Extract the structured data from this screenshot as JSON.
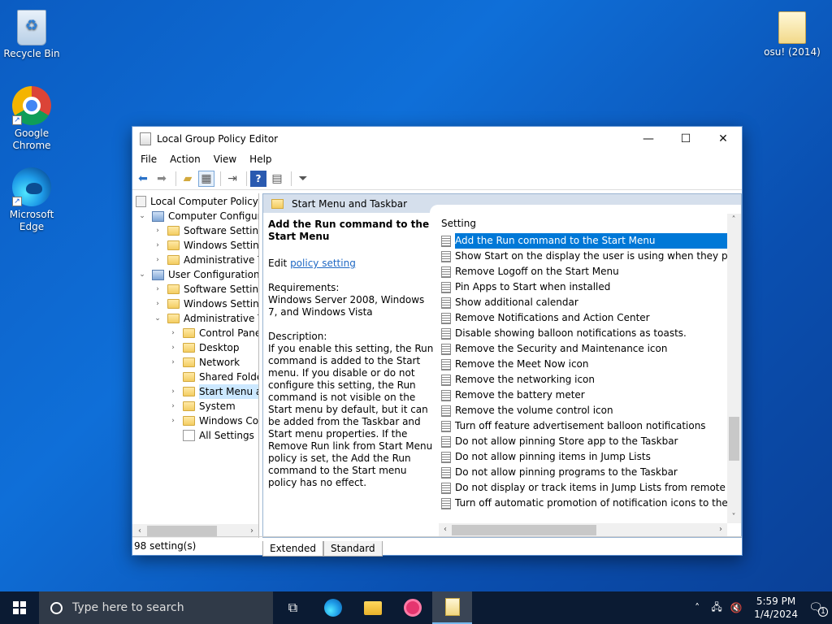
{
  "desktop": {
    "icons": [
      {
        "label": "Recycle Bin"
      },
      {
        "label": "Google Chrome"
      },
      {
        "label": "Microsoft Edge"
      },
      {
        "label": "osu! (2014)"
      }
    ]
  },
  "window": {
    "title": "Local Group Policy Editor",
    "menu": [
      "File",
      "Action",
      "View",
      "Help"
    ],
    "tree": [
      {
        "label": "Local Computer Policy",
        "expander": ""
      },
      {
        "label": "Computer Configura",
        "expander": "⌄"
      },
      {
        "label": "Software Settings",
        "expander": "›"
      },
      {
        "label": "Windows Setting",
        "expander": "›"
      },
      {
        "label": "Administrative Te",
        "expander": "›"
      },
      {
        "label": "User Configuration",
        "expander": "⌄"
      },
      {
        "label": "Software Settings",
        "expander": "›"
      },
      {
        "label": "Windows Setting",
        "expander": "›"
      },
      {
        "label": "Administrative Te",
        "expander": "⌄"
      },
      {
        "label": "Control Panel",
        "expander": "›"
      },
      {
        "label": "Desktop",
        "expander": "›"
      },
      {
        "label": "Network",
        "expander": "›"
      },
      {
        "label": "Shared Folder",
        "expander": ""
      },
      {
        "label": "Start Menu ar",
        "expander": "›"
      },
      {
        "label": "System",
        "expander": "›"
      },
      {
        "label": "Windows Cor",
        "expander": "›"
      },
      {
        "label": "All Settings",
        "expander": ""
      }
    ],
    "right_header": "Start Menu and Taskbar",
    "description": {
      "heading": "Add the Run command to the Start Menu",
      "edit_prefix": "Edit ",
      "edit_link": "policy setting ",
      "requirements": "Requirements:\nWindows Server 2008, Windows 7, and Windows Vista",
      "description": "Description:\nIf you enable this setting, the Run command is added to the Start menu.  If you disable or do not configure this setting, the Run command is not visible on the Start menu by default, but it can be added from the Taskbar and Start menu properties. If the Remove Run link from Start Menu policy is set, the Add the Run command to the Start menu policy has no effect."
    },
    "list_header": "Setting",
    "settings": [
      "Add the Run command to the Start Menu",
      "Show Start on the display the user is using when they press t...",
      "Remove Logoff on the Start Menu",
      "Pin Apps to Start when installed",
      "Show additional calendar",
      "Remove Notifications and Action Center",
      "Disable showing balloon notifications as toasts.",
      "Remove the Security and Maintenance icon",
      "Remove the Meet Now icon",
      "Remove the networking icon",
      "Remove the battery meter",
      "Remove the volume control icon",
      "Turn off feature advertisement balloon notifications",
      "Do not allow pinning Store app to the Taskbar",
      "Do not allow pinning items in Jump Lists",
      "Do not allow pinning programs to the Taskbar",
      "Do not display or track items in Jump Lists from remote loca...",
      "Turn off automatic promotion of notification icons to the ta..."
    ],
    "tabs": [
      "Extended",
      "Standard"
    ],
    "status": "98 setting(s)"
  },
  "taskbar": {
    "search_placeholder": "Type here to search",
    "time": "5:59 PM",
    "date": "1/4/2024",
    "notification_count": "1"
  }
}
